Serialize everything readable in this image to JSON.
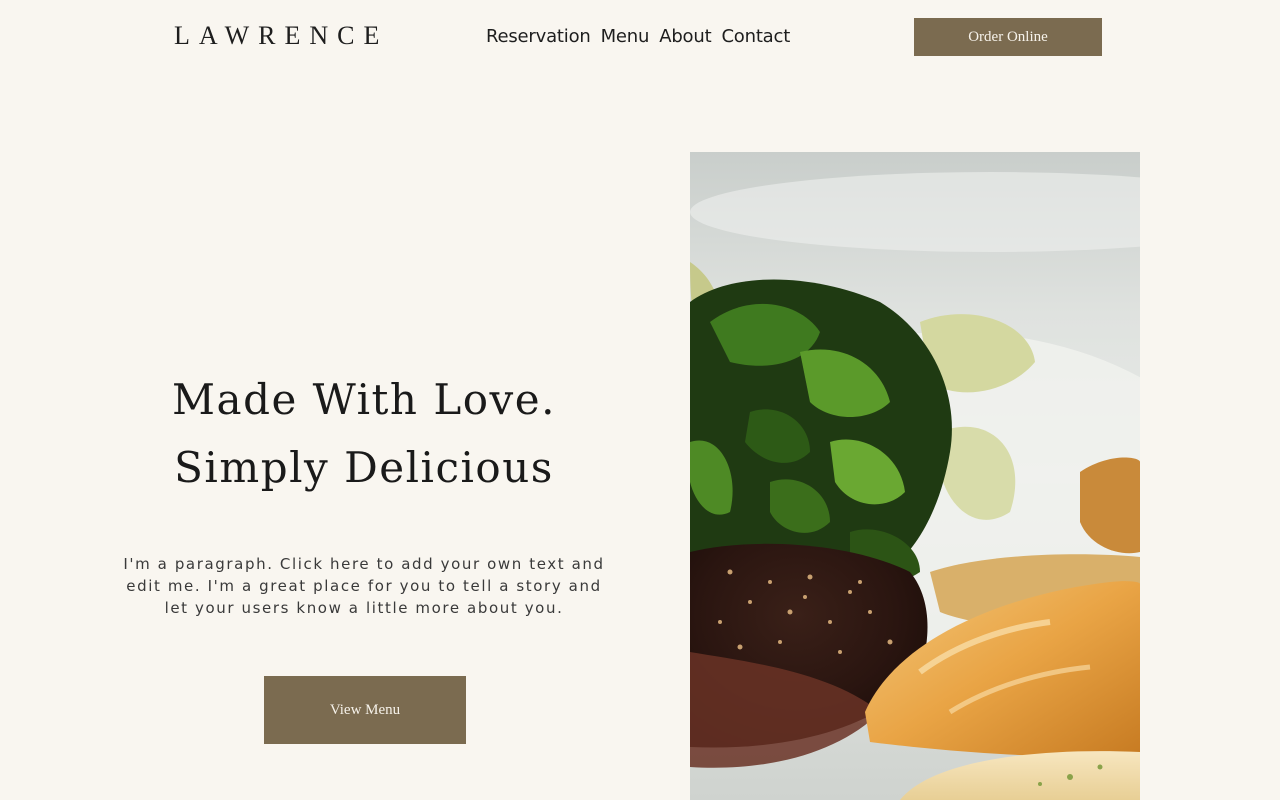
{
  "brand": {
    "logo": "LAWRENCE"
  },
  "nav": {
    "items": [
      {
        "label": "Reservation"
      },
      {
        "label": "Menu"
      },
      {
        "label": "About"
      },
      {
        "label": "Contact"
      }
    ],
    "order_label": "Order Online"
  },
  "hero": {
    "title_line1": "Made With Love.",
    "title_line2": "Simply Delicious",
    "paragraph": "I'm a paragraph. Click here to add your own text and edit me. I'm a great place for you to tell a story and let your users know a little more about you.",
    "cta_label": "View Menu"
  },
  "image": {
    "subject": "plated steak with greens and bread"
  },
  "colors": {
    "background": "#f9f6f0",
    "accent": "#7b6b50",
    "text": "#1e1e1e"
  }
}
